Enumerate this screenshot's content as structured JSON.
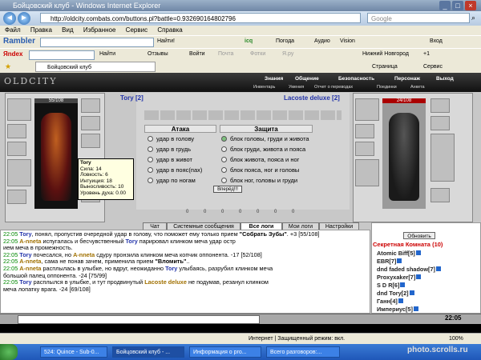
{
  "window": {
    "title": "Бойцовский клуб - Windows Internet Explorer"
  },
  "address": {
    "url": "http://oldcity.combats.com/buttons.pl?battle=0.932690164802796",
    "search_placeholder": "Google"
  },
  "menu": [
    "Файл",
    "Правка",
    "Вид",
    "Избранное",
    "Сервис",
    "Справка"
  ],
  "toolbar1": {
    "brand": "Rambler",
    "find": "Найти!",
    "icq": "icq",
    "weather": "Погода",
    "audio": "Аудио",
    "vision": "Vision",
    "login": "Вход"
  },
  "toolbar2": {
    "brand": "Яndex",
    "find": "Найти",
    "reviews": "Отзывы",
    "enter": "Войти",
    "mail": "Почта",
    "photos": "Фотки",
    "rss": "Я.ру",
    "city": "Нижний Новгород",
    "temp": "+1"
  },
  "favbar": {
    "tab": "Бойцовский клуб",
    "page": "Страница",
    "service": "Сервис"
  },
  "game": {
    "logo": "OLDCITY",
    "nav": [
      "Знания",
      "Общение",
      "Безопасность",
      "Персонаж",
      "Выход"
    ],
    "subnav": [
      "Инвентарь",
      "Умения",
      "Отчет о переводах",
      "Поединки",
      "Анкета"
    ],
    "left": {
      "name": "Tory [2]",
      "hp": "55/108"
    },
    "right": {
      "name": "Lacoste deluxe [2]",
      "hp": "24/108"
    },
    "tooltip": [
      "Tory",
      "Сила: 14",
      "Ловкость: 6",
      "Интуиция: 18",
      "Выносливость: 10",
      "Уровень духа: 0.00"
    ],
    "attack": {
      "title": "Атака",
      "options": [
        "удар в голову",
        "удар в грудь",
        "удар в живот",
        "удар в пояс(пах)",
        "удар по ногам"
      ]
    },
    "defense": {
      "title": "Защита",
      "options": [
        "блок головы, груди и живота",
        "блок груди, живота и пояса",
        "блок живота, пояса и ног",
        "блок пояса, ног и головы",
        "блок ног, головы и груди"
      ]
    },
    "forward": "Вперёд!!!",
    "counters": [
      "0",
      "0",
      "0",
      "0",
      "0",
      "0",
      "0"
    ],
    "tabs": [
      "Чат",
      "Системные сообщения",
      "Все логи",
      "Мои логи",
      "Настройки"
    ],
    "chat": [
      {
        "time": "22:05",
        "a": "Tory",
        "t1": ", понял, пропустив очередной удар в голову, что поможет ему только прием ",
        "b": "\"Собрать Зубы\"",
        "t2": ". +3 [55/108]"
      },
      {
        "time": "22:05",
        "a": "A-nneta",
        "t1": " испугалась и бесчувственный ",
        "b": "Tory",
        "t2": " парировал клинком меча удар остр"
      },
      {
        "time": "",
        "a": "",
        "t1": "ием меча в промежность.",
        "b": "",
        "t2": ""
      },
      {
        "time": "22:05",
        "a": "Tory",
        "t1": " почесался, но ",
        "b": "A-nneta",
        "t2": " сдуру пронзила клинком меча копчик оппонента. -17 [52/108]"
      },
      {
        "time": "22:05",
        "a": "A-nneta",
        "t1": ", сама не понав зачем, применила прием ",
        "b": "\"Вломить\"",
        "t2": ".."
      },
      {
        "time": "22:05",
        "a": "A-nneta",
        "t1": " расплылась в улыбке, но вдруг, неожиданно ",
        "b": "Tory",
        "t2": " улыбаясь, разрубил клинком меча"
      },
      {
        "time": "",
        "a": "",
        "t1": "большой палец оппонента. -24 [75/99]",
        "b": "",
        "t2": ""
      },
      {
        "time": "22:05",
        "a": "Tory",
        "t1": " расплылся в улыбке, и тут продвинутый ",
        "b": "Lacoste deluxe",
        "t2": " не подумав, резанул клинком"
      },
      {
        "time": "",
        "a": "",
        "t1": "меча лопатку врага. -24 [69/108]",
        "b": "",
        "t2": ""
      }
    ],
    "side": {
      "refresh": "Обновить",
      "room": "Секретная Комната (10)",
      "members": [
        "Atomic Biff[5]",
        "EBR[7]",
        "dnd faded shadow[7]",
        "Proxyxaker[7]",
        "S D R[6]",
        "dnd Tory[2]",
        "Ганн[4]",
        "Империус[5]"
      ]
    },
    "time": "22:05"
  },
  "statusbar": {
    "zone": "Интернет | Защищенный режим: вкл.",
    "zoom": "100%"
  },
  "taskbar": [
    "524: Quince - Sub-0...",
    "Бойцовский клуб - ...",
    "Информация о pro...",
    "Всего разговоров:..."
  ],
  "watermark": "photo.scrolls.ru"
}
